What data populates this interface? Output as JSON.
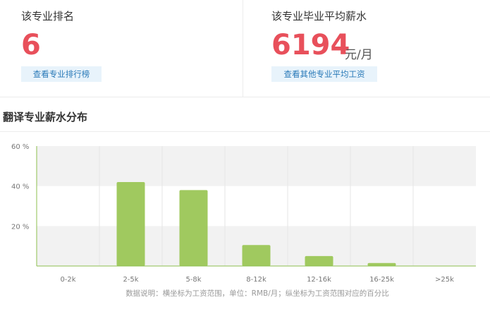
{
  "rank": {
    "label": "该专业排名",
    "value": "6",
    "button": "查看专业排行榜"
  },
  "salary": {
    "label": "该专业毕业平均薪水",
    "value": "6194",
    "unit": "元/月",
    "button": "查看其他专业平均工资"
  },
  "section": {
    "title": "翻译专业薪水分布"
  },
  "colors": {
    "accent_red": "#e8505b",
    "bar_green": "#a0c95f",
    "link_blue": "#2a7ab8"
  },
  "chart_data": {
    "type": "bar",
    "title": "",
    "caption": "数据说明：横坐标为工资范围，单位：RMB/月；纵坐标为工资范围对应的百分比",
    "categories": [
      "0-2k",
      "2-5k",
      "5-8k",
      "8-12k",
      "12-16k",
      "16-25k",
      ">25k"
    ],
    "values": [
      0,
      42,
      38,
      10.5,
      5,
      1.5,
      0
    ],
    "y_ticks": [
      "20 %",
      "40 %",
      "60 %"
    ],
    "ylim": [
      0,
      60
    ],
    "grid": true
  }
}
